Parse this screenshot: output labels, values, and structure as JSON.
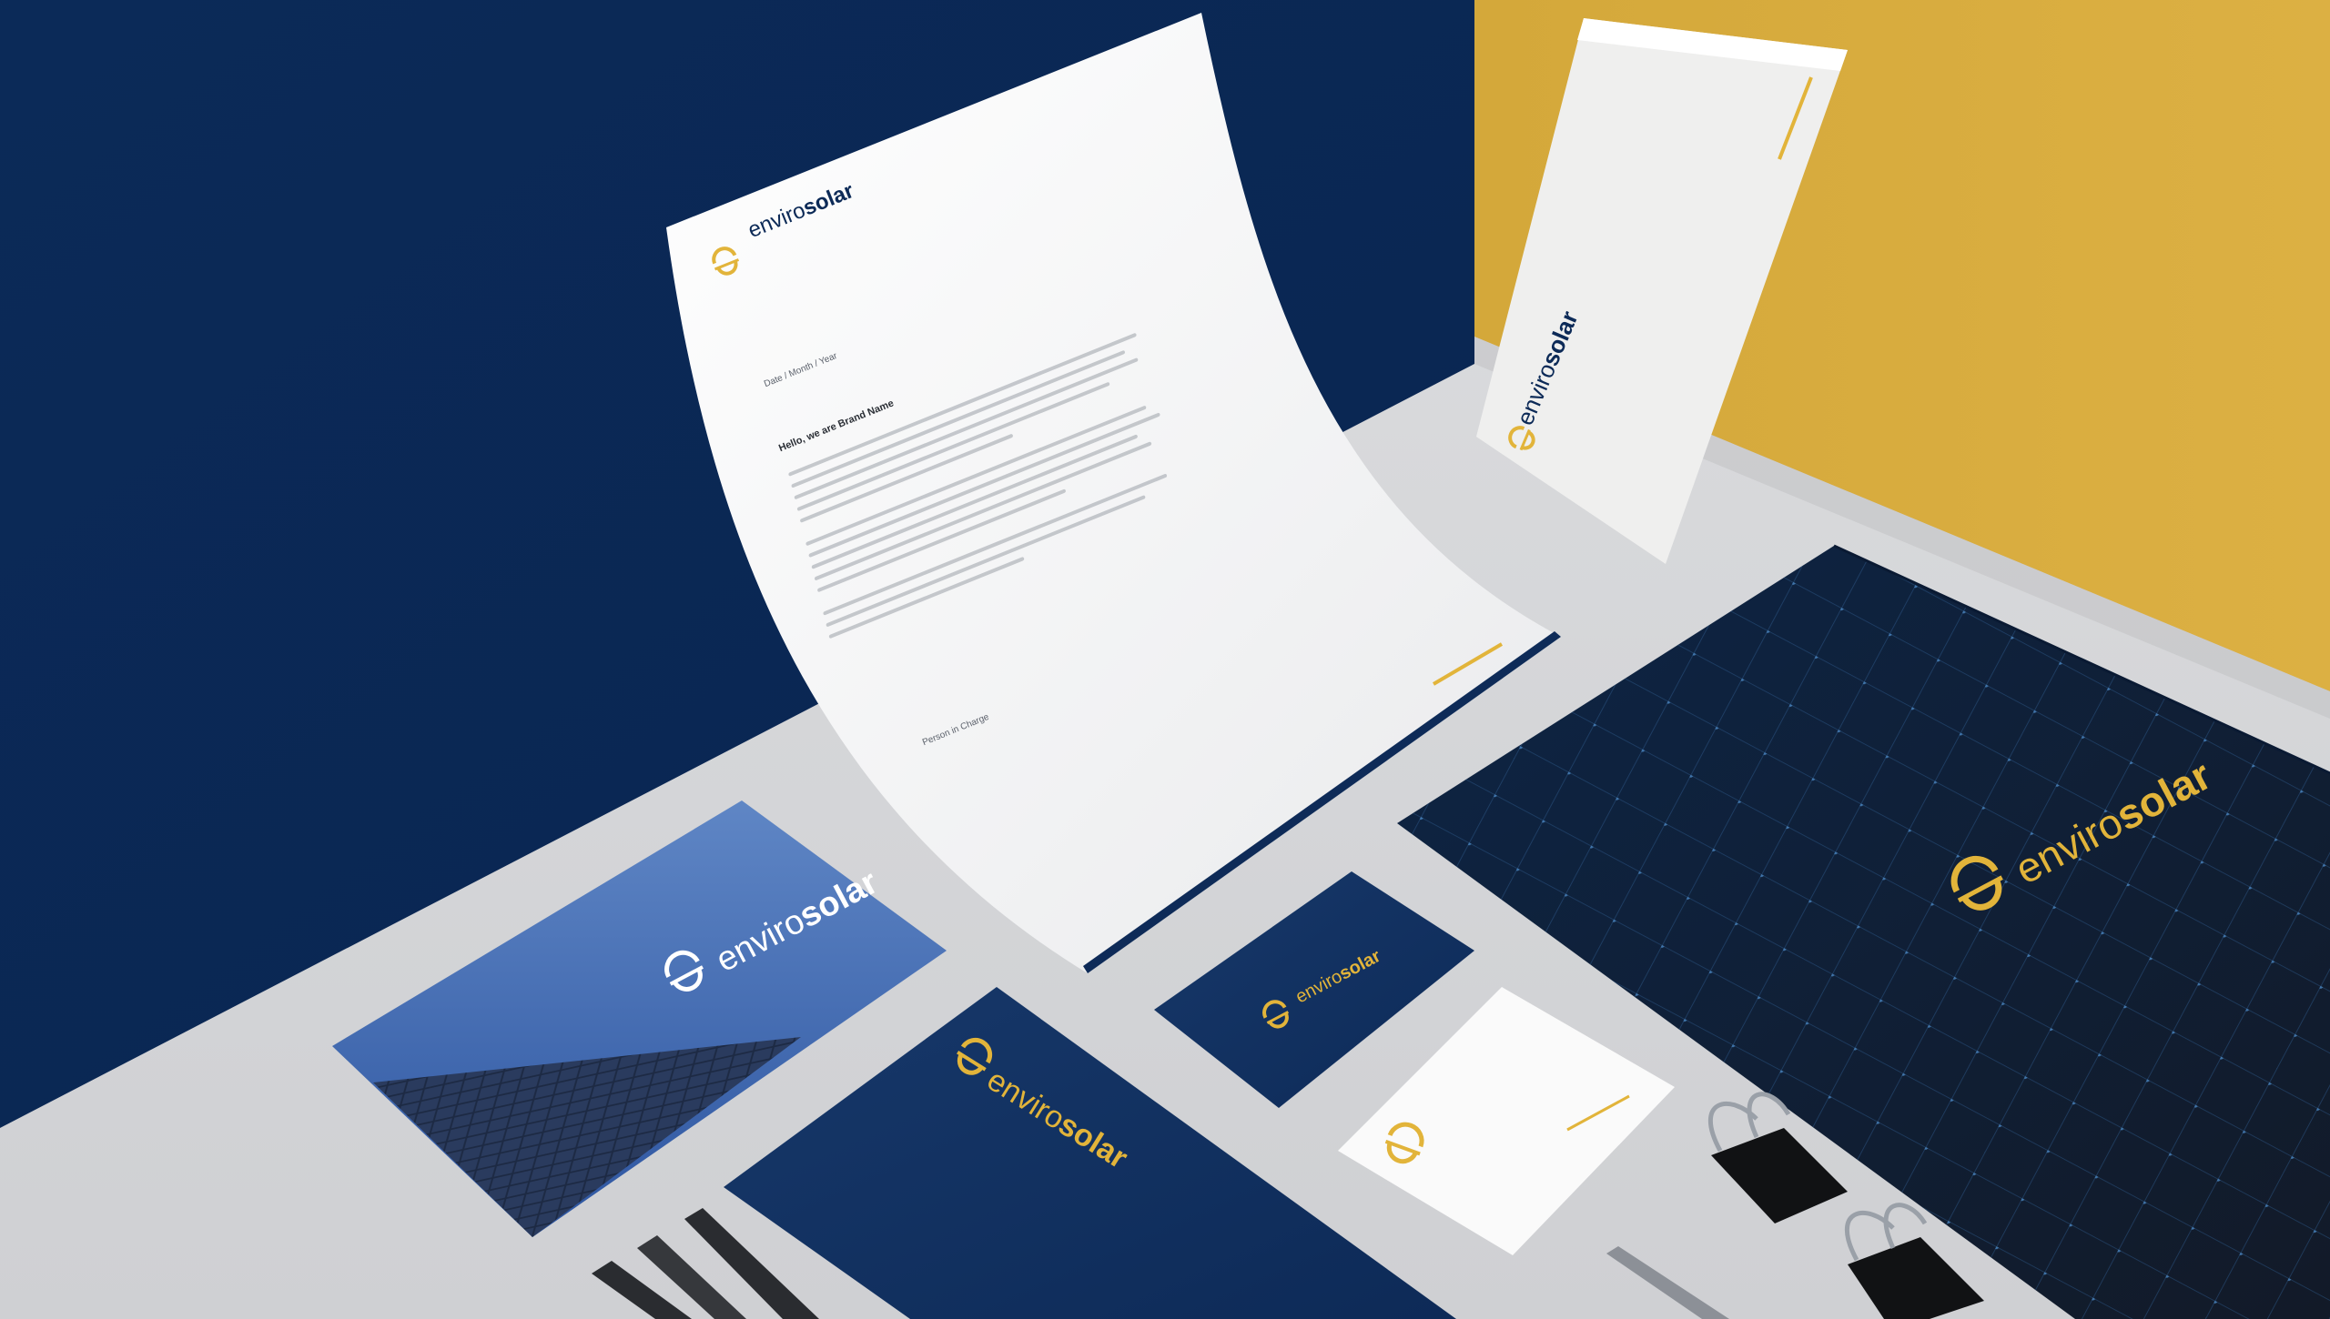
{
  "brand": {
    "prefix": "enviro",
    "suffix": "solar",
    "colors": {
      "navy": "#0c2a57",
      "gold": "#e2b43a",
      "mustard_wall": "#d7ac3c",
      "desk": "#d7d8da",
      "white": "#f6f6f5"
    }
  },
  "letterhead": {
    "date_line": "Date / Month / Year",
    "greeting": "Hello, we are Brand Name",
    "signoff": "Person in Charge"
  },
  "icons": {
    "logo_mark": "sun-over-horizon-icon",
    "binder_clip": "binder-clip-icon",
    "pencil": "pencil-icon",
    "pen": "pen-icon"
  }
}
